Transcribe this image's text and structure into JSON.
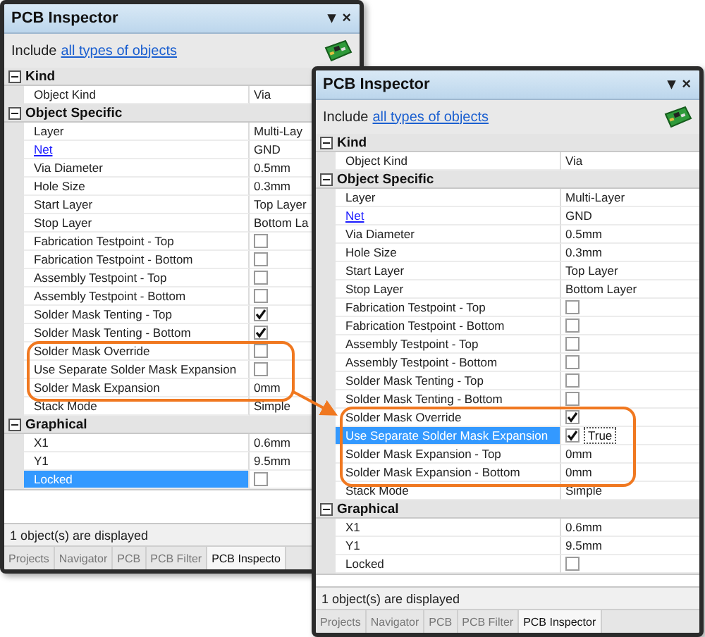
{
  "windows": [
    {
      "title": "PCB Inspector",
      "menu_glyph": "▾",
      "close_glyph": "×",
      "include_prefix": "Include",
      "include_link": "all types of objects",
      "sections": [
        {
          "title": "Kind",
          "expanded": true,
          "rows": [
            {
              "label": "Object Kind",
              "kind": "text",
              "value": "Via",
              "selected": false
            }
          ]
        },
        {
          "title": "Object Specific",
          "expanded": true,
          "rows": [
            {
              "label": "Layer",
              "kind": "text",
              "value": "Multi-Lay",
              "selected": false
            },
            {
              "label": "Net",
              "kind": "link",
              "value": "GND",
              "selected": false
            },
            {
              "label": "Via Diameter",
              "kind": "text",
              "value": "0.5mm",
              "selected": false
            },
            {
              "label": "Hole Size",
              "kind": "text",
              "value": "0.3mm",
              "selected": false
            },
            {
              "label": "Start Layer",
              "kind": "text",
              "value": "Top Layer",
              "selected": false
            },
            {
              "label": "Stop Layer",
              "kind": "text",
              "value": "Bottom La",
              "selected": false
            },
            {
              "label": "Fabrication Testpoint - Top",
              "kind": "check",
              "checked": false,
              "selected": false
            },
            {
              "label": "Fabrication Testpoint - Bottom",
              "kind": "check",
              "checked": false,
              "selected": false
            },
            {
              "label": "Assembly Testpoint - Top",
              "kind": "check",
              "checked": false,
              "selected": false
            },
            {
              "label": "Assembly Testpoint - Bottom",
              "kind": "check",
              "checked": false,
              "selected": false
            },
            {
              "label": "Solder Mask Tenting - Top",
              "kind": "check",
              "checked": true,
              "selected": false
            },
            {
              "label": "Solder Mask Tenting - Bottom",
              "kind": "check",
              "checked": true,
              "selected": false
            },
            {
              "label": "Solder Mask Override",
              "kind": "check",
              "checked": false,
              "selected": false
            },
            {
              "label": "Use Separate Solder Mask Expansion",
              "kind": "check",
              "checked": false,
              "selected": false
            },
            {
              "label": "Solder Mask Expansion",
              "kind": "text",
              "value": "0mm",
              "selected": false
            },
            {
              "label": "Stack Mode",
              "kind": "text",
              "value": "Simple",
              "selected": false
            }
          ]
        },
        {
          "title": "Graphical",
          "expanded": true,
          "rows": [
            {
              "label": "X1",
              "kind": "text",
              "value": "0.6mm",
              "selected": false
            },
            {
              "label": "Y1",
              "kind": "text",
              "value": "9.5mm",
              "selected": false
            },
            {
              "label": "Locked",
              "kind": "check",
              "checked": false,
              "selected": true
            }
          ]
        }
      ],
      "status": "1 object(s) are displayed",
      "tabs": [
        {
          "label": "Projects",
          "selected": false
        },
        {
          "label": "Navigator",
          "selected": false
        },
        {
          "label": "PCB",
          "selected": false
        },
        {
          "label": "PCB Filter",
          "selected": false
        },
        {
          "label": "PCB Inspecto",
          "selected": true
        }
      ]
    },
    {
      "title": "PCB Inspector",
      "menu_glyph": "▾",
      "close_glyph": "×",
      "include_prefix": "Include",
      "include_link": "all types of objects",
      "sections": [
        {
          "title": "Kind",
          "expanded": true,
          "rows": [
            {
              "label": "Object Kind",
              "kind": "text",
              "value": "Via",
              "selected": false
            }
          ]
        },
        {
          "title": "Object Specific",
          "expanded": true,
          "rows": [
            {
              "label": "Layer",
              "kind": "text",
              "value": "Multi-Layer",
              "selected": false
            },
            {
              "label": "Net",
              "kind": "link",
              "value": "GND",
              "selected": false
            },
            {
              "label": "Via Diameter",
              "kind": "text",
              "value": "0.5mm",
              "selected": false
            },
            {
              "label": "Hole Size",
              "kind": "text",
              "value": "0.3mm",
              "selected": false
            },
            {
              "label": "Start Layer",
              "kind": "text",
              "value": "Top Layer",
              "selected": false
            },
            {
              "label": "Stop Layer",
              "kind": "text",
              "value": "Bottom Layer",
              "selected": false
            },
            {
              "label": "Fabrication Testpoint - Top",
              "kind": "check",
              "checked": false,
              "selected": false
            },
            {
              "label": "Fabrication Testpoint - Bottom",
              "kind": "check",
              "checked": false,
              "selected": false
            },
            {
              "label": "Assembly Testpoint - Top",
              "kind": "check",
              "checked": false,
              "selected": false
            },
            {
              "label": "Assembly Testpoint - Bottom",
              "kind": "check",
              "checked": false,
              "selected": false
            },
            {
              "label": "Solder Mask Tenting - Top",
              "kind": "check",
              "checked": false,
              "selected": false
            },
            {
              "label": "Solder Mask Tenting - Bottom",
              "kind": "check",
              "checked": false,
              "selected": false
            },
            {
              "label": "Solder Mask Override",
              "kind": "check",
              "checked": true,
              "selected": false
            },
            {
              "label": "Use Separate Solder Mask Expansion",
              "kind": "check-edit",
              "checked": true,
              "edit_text": "True",
              "selected": true
            },
            {
              "label": "Solder Mask Expansion - Top",
              "kind": "text",
              "value": "0mm",
              "selected": false
            },
            {
              "label": "Solder Mask Expansion - Bottom",
              "kind": "text",
              "value": "0mm",
              "selected": false
            },
            {
              "label": "Stack Mode",
              "kind": "text",
              "value": "Simple",
              "selected": false
            }
          ]
        },
        {
          "title": "Graphical",
          "expanded": true,
          "rows": [
            {
              "label": "X1",
              "kind": "text",
              "value": "0.6mm",
              "selected": false
            },
            {
              "label": "Y1",
              "kind": "text",
              "value": "9.5mm",
              "selected": false
            },
            {
              "label": "Locked",
              "kind": "check",
              "checked": false,
              "selected": false
            }
          ]
        }
      ],
      "status": "1 object(s) are displayed",
      "tabs": [
        {
          "label": "Projects",
          "selected": false
        },
        {
          "label": "Navigator",
          "selected": false
        },
        {
          "label": "PCB",
          "selected": false
        },
        {
          "label": "PCB Filter",
          "selected": false
        },
        {
          "label": "PCB Inspector",
          "selected": true
        }
      ]
    }
  ]
}
